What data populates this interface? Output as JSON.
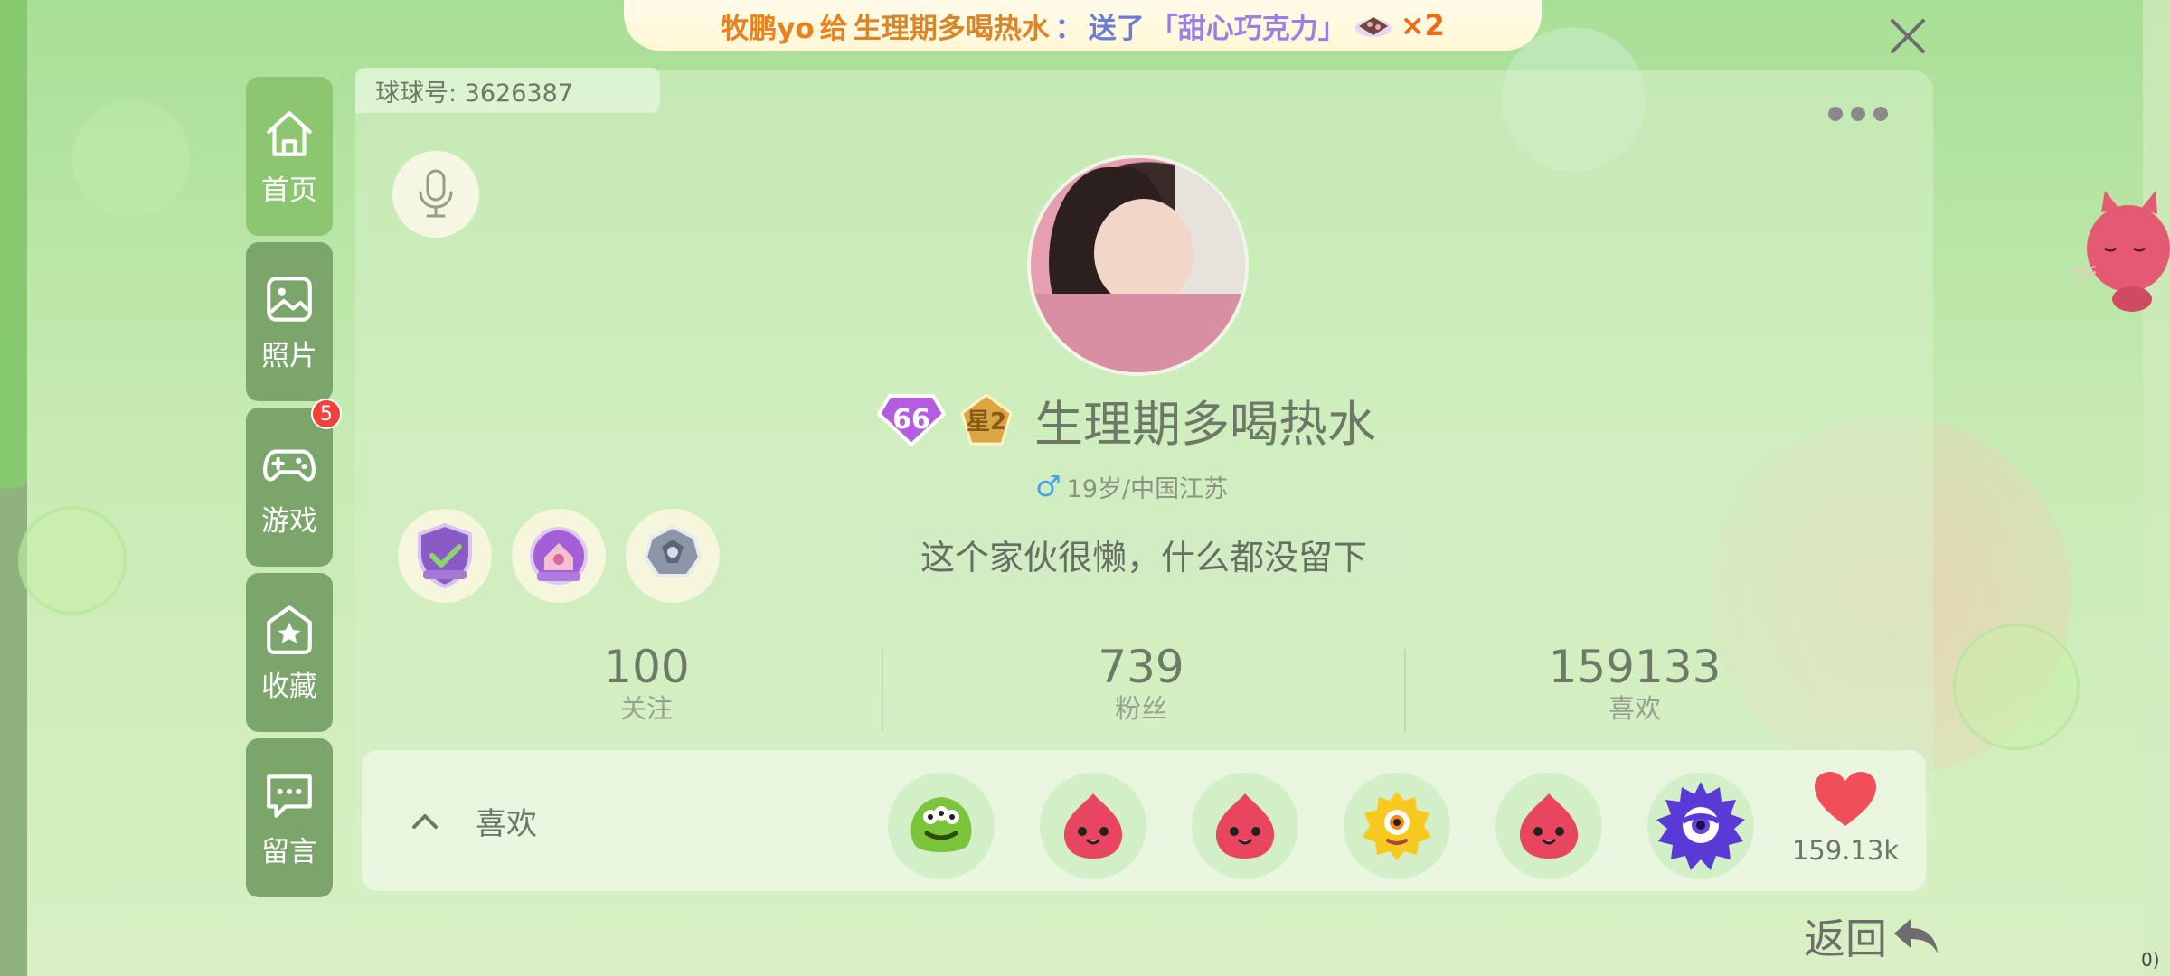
{
  "banner": {
    "sender": "牧鹏yo",
    "gave": "给",
    "receiver": "生理期多喝热水",
    "colon": "：",
    "action": "送了",
    "gift": "「甜心巧克力」",
    "count": "×2"
  },
  "profile": {
    "uid": "球球号: 3626387",
    "level": "66",
    "star_level": "星2",
    "nickname": "生理期多喝热水",
    "gender_symbol": "♂",
    "info": "19岁/中国江苏",
    "signature": "这个家伙很懒，什么都没留下"
  },
  "nav": {
    "items": [
      {
        "label": "首页",
        "icon": "home-icon"
      },
      {
        "label": "照片",
        "icon": "photo-icon"
      },
      {
        "label": "游戏",
        "icon": "gamepad-icon",
        "badge": "5"
      },
      {
        "label": "收藏",
        "icon": "star-icon"
      },
      {
        "label": "留言",
        "icon": "message-icon"
      }
    ]
  },
  "stats": [
    {
      "value": "100",
      "label": "关注"
    },
    {
      "value": "739",
      "label": "粉丝"
    },
    {
      "value": "159133",
      "label": "喜欢"
    }
  ],
  "likes": {
    "label": "喜欢",
    "count": "159.13k",
    "likers": [
      "green-monster-avatar",
      "red-blob-avatar",
      "red-blob-avatar",
      "yellow-cyclops-avatar",
      "red-blob-avatar",
      "purple-spiky-avatar"
    ]
  },
  "back_label": "返回",
  "corner_text": "0)",
  "colors": {
    "nav_bg": "#7ca56c",
    "nav_active": "#8cc671",
    "badge": "#f0413a",
    "heart": "#f04f5a",
    "banner_text": "#e8821e"
  }
}
